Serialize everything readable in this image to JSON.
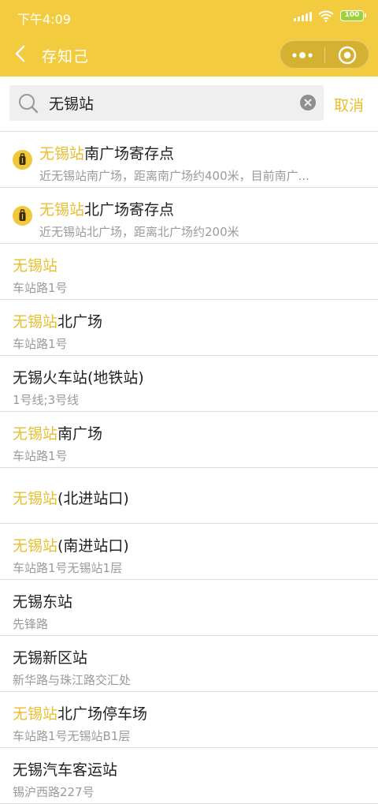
{
  "status_bar": {
    "time": "下午4:09",
    "battery": "100"
  },
  "nav": {
    "title": "存知己"
  },
  "search": {
    "value": "无锡站",
    "cancel_label": "取消"
  },
  "results": [
    {
      "highlight": "无锡站",
      "rest": "南广场寄存点",
      "subtitle": "近无锡站南广场，距离南广场约400米，目前南广...",
      "pin": true
    },
    {
      "highlight": "无锡站",
      "rest": "北广场寄存点",
      "subtitle": "近无锡站北广场，距离北广场约200米",
      "pin": true
    },
    {
      "highlight": "无锡站",
      "rest": "",
      "subtitle": "车站路1号",
      "pin": false
    },
    {
      "highlight": "无锡站",
      "rest": "北广场",
      "subtitle": "车站路1号",
      "pin": false
    },
    {
      "highlight": "",
      "rest": "无锡火车站(地铁站)",
      "subtitle": "1号线;3号线",
      "pin": false
    },
    {
      "highlight": "无锡站",
      "rest": "南广场",
      "subtitle": "车站路1号",
      "pin": false
    },
    {
      "highlight": "无锡站",
      "rest": "(北进站口)",
      "subtitle": "",
      "pin": false
    },
    {
      "highlight": "无锡站",
      "rest": "(南进站口)",
      "subtitle": "车站路1号无锡站1层",
      "pin": false
    },
    {
      "highlight": "",
      "rest": "无锡东站",
      "subtitle": "先锋路",
      "pin": false
    },
    {
      "highlight": "",
      "rest": "无锡新区站",
      "subtitle": "新华路与珠江路交汇处",
      "pin": false
    },
    {
      "highlight": "无锡站",
      "rest": "北广场停车场",
      "subtitle": "车站路1号无锡站B1层",
      "pin": false
    },
    {
      "highlight": "",
      "rest": "无锡汽车客运站",
      "subtitle": "锡沪西路227号",
      "pin": false
    }
  ],
  "colors": {
    "brand": "#f2cb3e",
    "highlight": "#e9be2f",
    "battery": "#9ed23d"
  },
  "icons": {
    "back": "chevron-left-icon",
    "more": "more-dots-icon",
    "close": "target-circle-icon",
    "search": "search-icon",
    "clear": "clear-icon",
    "pin": "luggage-pin-icon"
  }
}
